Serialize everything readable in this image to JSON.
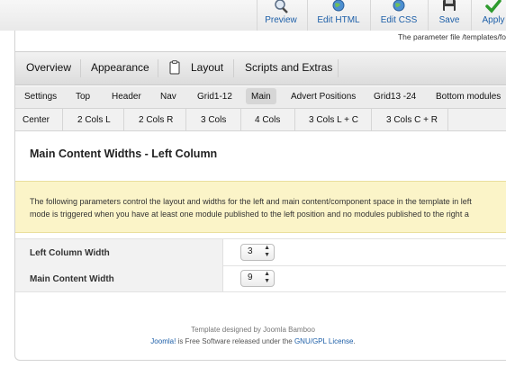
{
  "toolbar": {
    "buttons": [
      {
        "label": "Preview",
        "icon": "magnifier-icon"
      },
      {
        "label": "Edit HTML",
        "icon": "globe-icon"
      },
      {
        "label": "Edit CSS",
        "icon": "globe-icon"
      },
      {
        "label": "Save",
        "icon": "floppy-disk-icon"
      },
      {
        "label": "Apply",
        "icon": "checkmark-icon"
      }
    ]
  },
  "param_file": "The parameter file /templates/fo",
  "main_nav": {
    "items": [
      "Overview",
      "Appearance",
      "Layout",
      "Scripts and Extras"
    ],
    "layout_icon": "clipboard-icon"
  },
  "sub_nav": {
    "items": [
      "Settings",
      "Top",
      "Header",
      "Nav",
      "Grid1-12",
      "Main",
      "Advert Positions",
      "Grid13 -24",
      "Bottom modules"
    ],
    "active": "Main"
  },
  "sub_nav2": {
    "items": [
      "Center",
      "2 Cols L",
      "2 Cols R",
      "3 Cols",
      "4 Cols",
      "3 Cols L + C",
      "3 Cols C + R"
    ]
  },
  "section_title": "Main Content Widths - Left Column",
  "notice": {
    "line1": "The following parameters control the layout and widths for the left and main content/component space in the template in left",
    "line2": "mode is triggered when you have at least one module published to the left position and no modules published to the right a"
  },
  "fields": [
    {
      "label": "Left Column Width",
      "value": "3"
    },
    {
      "label": "Main Content Width",
      "value": "9"
    }
  ],
  "footer": {
    "credit": "Template designed by Joomla Bamboo",
    "joomla_link": "Joomla!",
    "middle_text": " is Free Software released under the ",
    "license_link": "GNU/GPL License",
    "end": "."
  },
  "colors": {
    "link": "#1d5fa8",
    "notice_bg": "#fbf4c8",
    "apply_green": "#2e9b2e"
  }
}
